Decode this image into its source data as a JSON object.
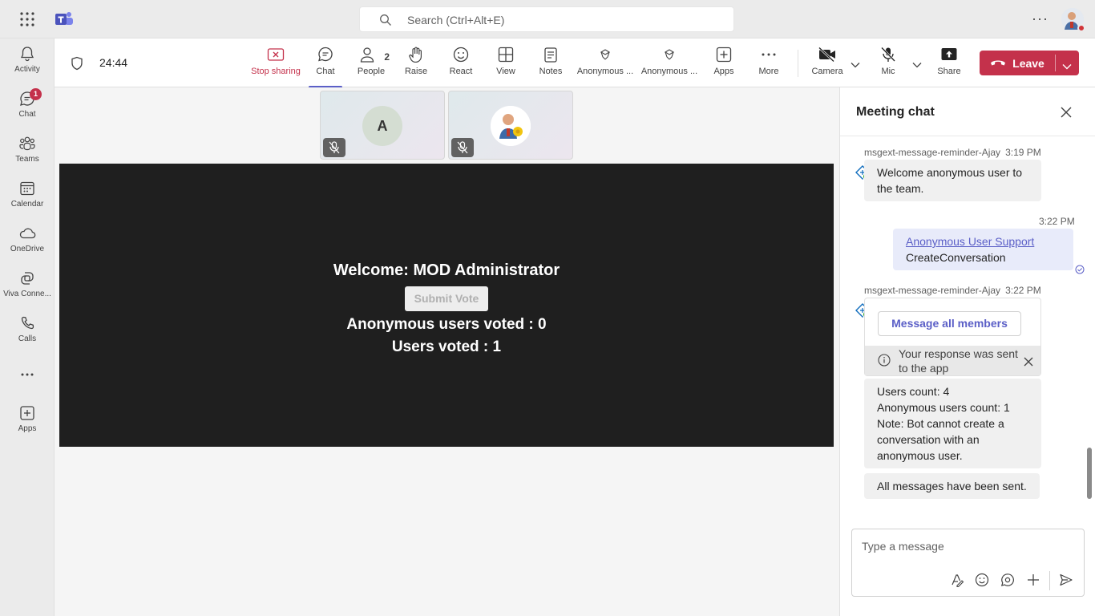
{
  "titlebar": {
    "search_placeholder": "Search (Ctrl+Alt+E)"
  },
  "rail": {
    "items": [
      {
        "label": "Activity",
        "icon": "bell-icon"
      },
      {
        "label": "Chat",
        "icon": "chat-icon",
        "badge": "1"
      },
      {
        "label": "Teams",
        "icon": "teams-icon"
      },
      {
        "label": "Calendar",
        "icon": "calendar-icon"
      },
      {
        "label": "OneDrive",
        "icon": "cloud-icon"
      },
      {
        "label": "Viva Conne...",
        "icon": "viva-icon"
      },
      {
        "label": "Calls",
        "icon": "phone-icon"
      },
      {
        "label": "Apps",
        "icon": "add-apps-icon"
      }
    ]
  },
  "toolbar": {
    "timer": "24:44",
    "buttons": {
      "stop_sharing": "Stop sharing",
      "chat": "Chat",
      "people": "People",
      "people_count": "2",
      "raise": "Raise",
      "react": "React",
      "view": "View",
      "notes": "Notes",
      "anon1": "Anonymous ...",
      "anon2": "Anonymous ...",
      "apps": "Apps",
      "more": "More",
      "camera": "Camera",
      "mic": "Mic",
      "share": "Share"
    },
    "leave": "Leave"
  },
  "stage": {
    "participants": [
      {
        "initial": "A"
      },
      {
        "initial": ""
      }
    ],
    "share": {
      "welcome": "Welcome: MOD Administrator",
      "submit": "Submit Vote",
      "anon_voted": "Anonymous users voted : 0",
      "users_voted": "Users voted : 1"
    }
  },
  "chat": {
    "title": "Meeting chat",
    "messages": {
      "m1_sender": "msgext-message-reminder-Ajay",
      "m1_time": "3:19 PM",
      "m1_line1": "Welcome anonymous user to",
      "m1_line2": "the team.",
      "m2_time": "3:22 PM",
      "m2_link": "Anonymous User Support",
      "m2_text": "CreateConversation",
      "m3_sender": "msgext-message-reminder-Ajay",
      "m3_time": "3:22 PM",
      "m3_button": "Message all members",
      "m3_note_line1": "Your response was sent",
      "m3_note_line2": "to the app",
      "m4_line1": "Users count: 4",
      "m4_line2": "Anonymous users count: 1",
      "m4_line3": "Note: Bot cannot create a",
      "m4_line4": "conversation with an",
      "m4_line5": "anonymous user.",
      "m5_text": "All messages have been sent."
    },
    "compose_placeholder": "Type a message"
  },
  "colors": {
    "accent": "#5b5fc7",
    "leave": "#c4314b",
    "share_bg": "#1f1f1f"
  }
}
